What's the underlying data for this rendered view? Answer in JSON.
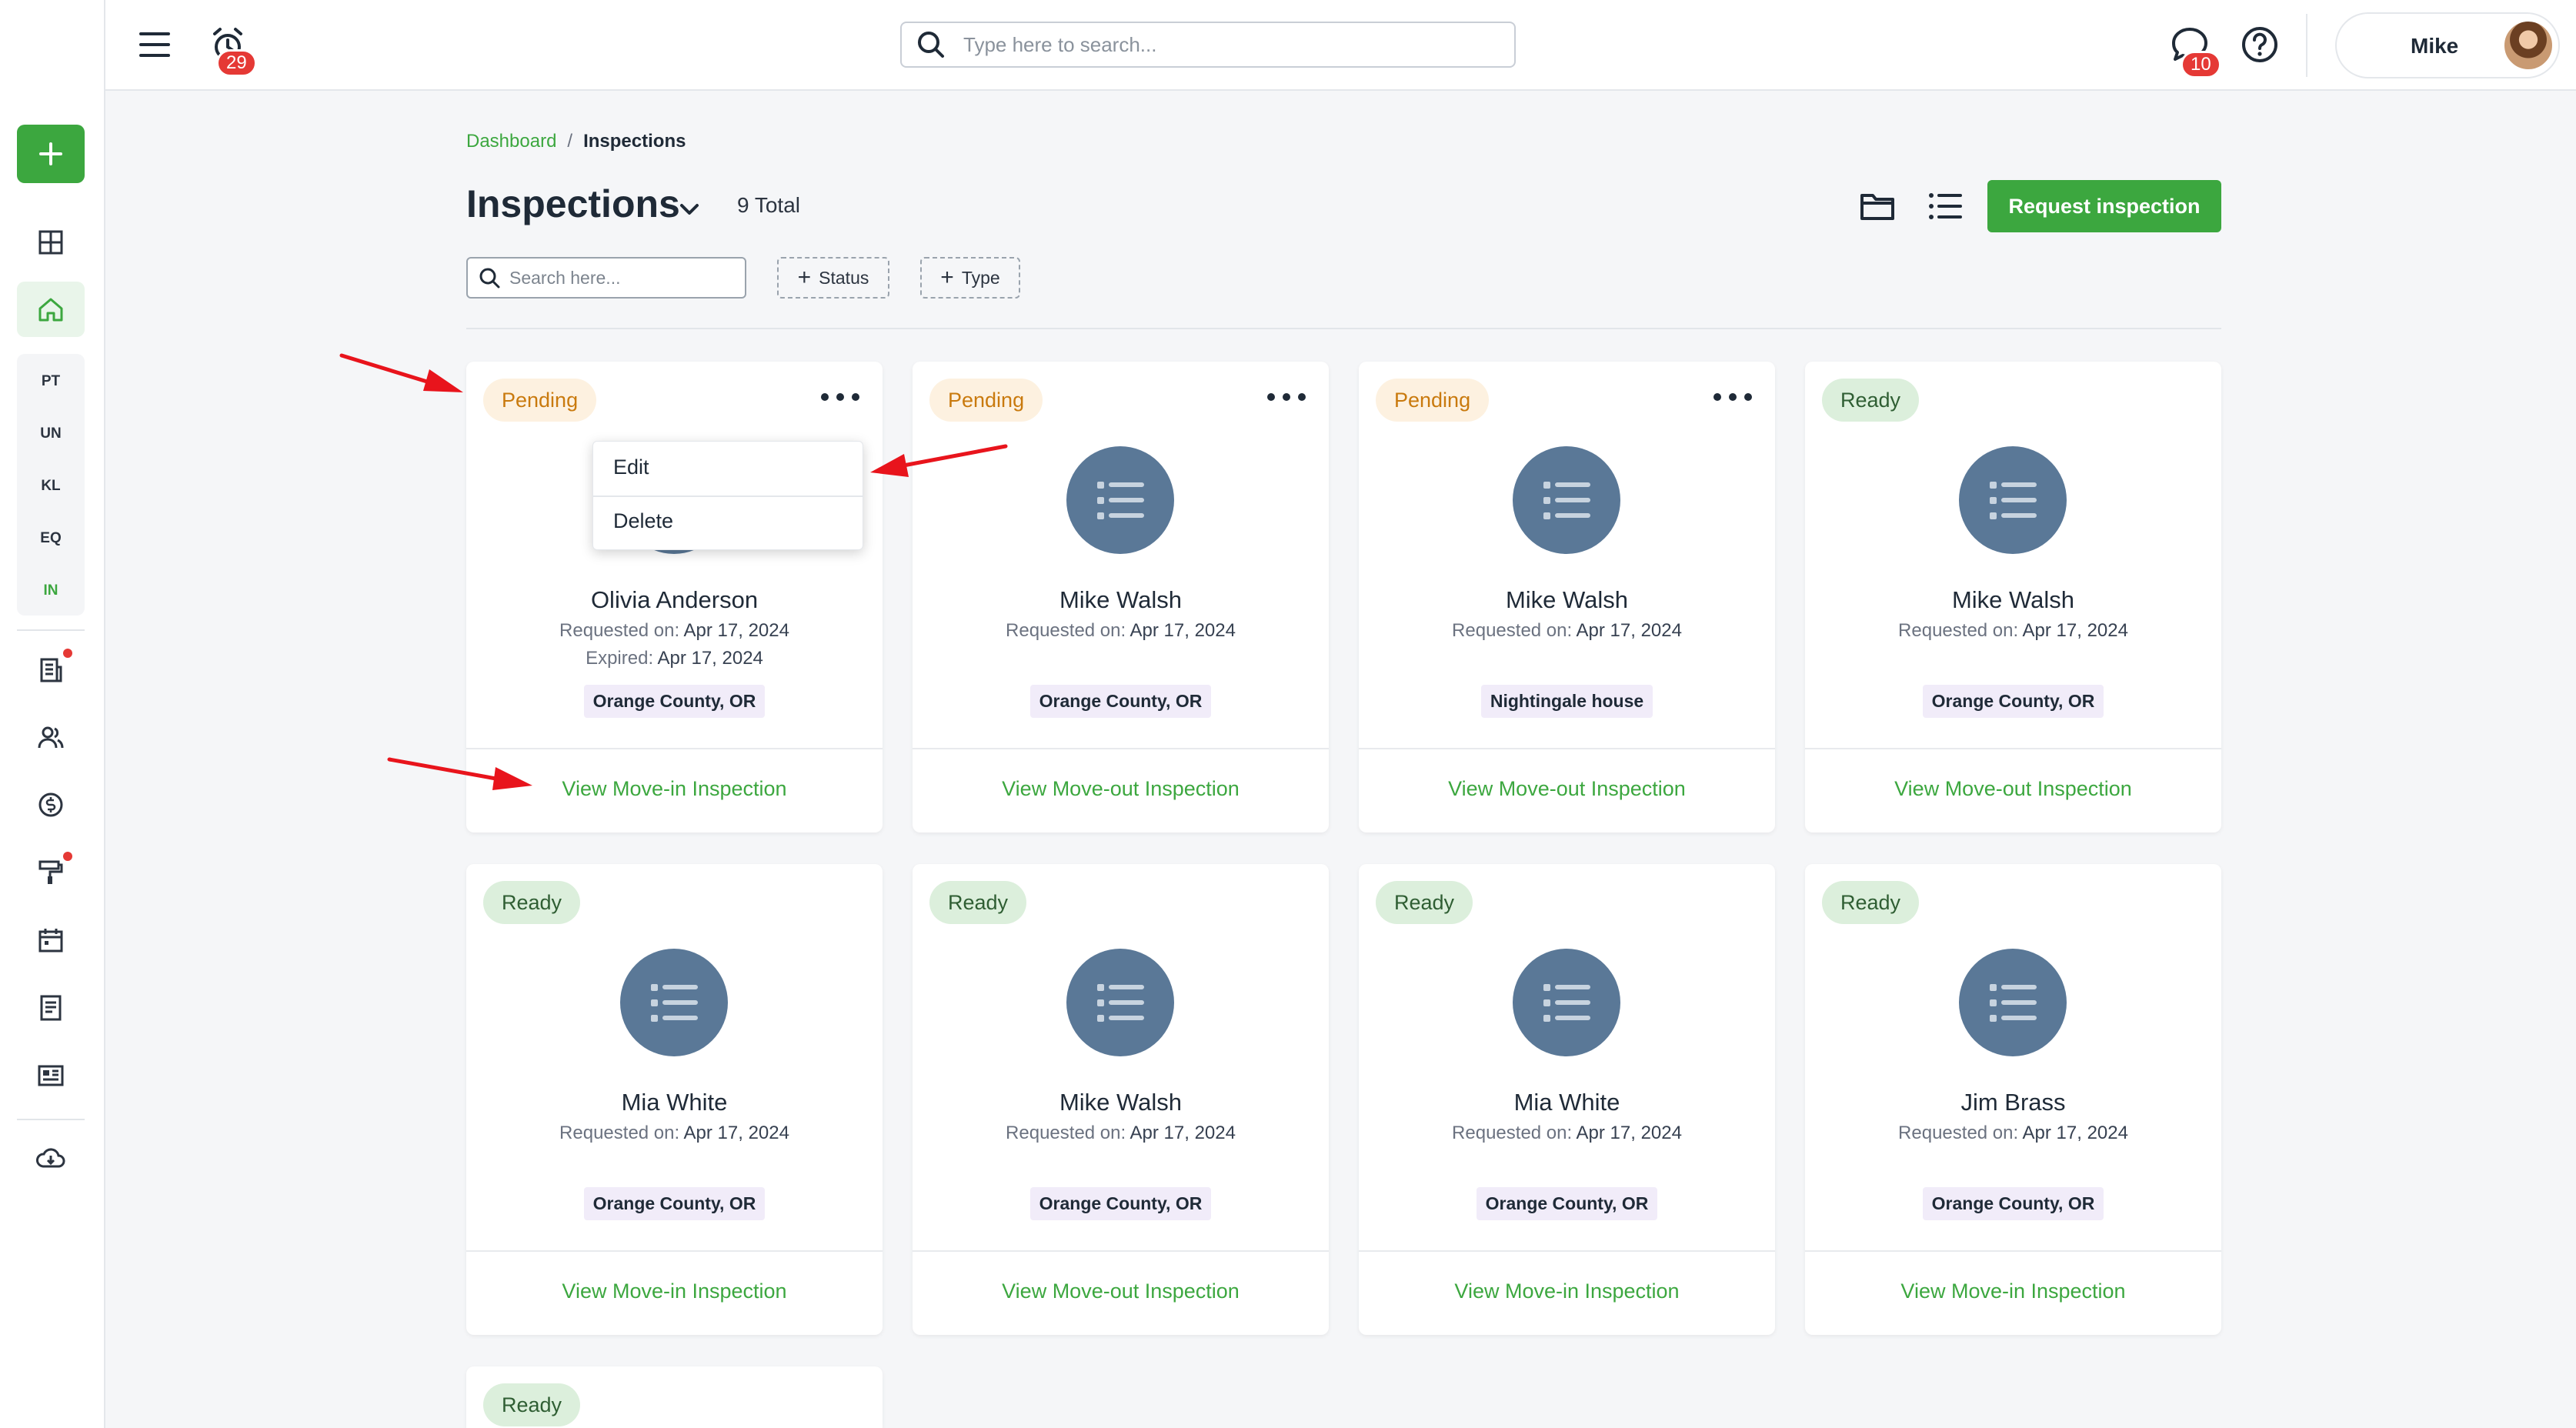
{
  "topbar": {
    "alarm_badge": "29",
    "search_placeholder": "Type here to search...",
    "chat_badge": "10",
    "user_name": "Mike"
  },
  "sidebar": {
    "abbreviations": [
      "PT",
      "UN",
      "KL",
      "EQ",
      "IN"
    ],
    "active_abbreviation": "IN"
  },
  "breadcrumb": {
    "root": "Dashboard",
    "separator": "/",
    "current": "Inspections"
  },
  "header": {
    "title": "Inspections",
    "total": "9 Total",
    "request_button": "Request inspection",
    "filter_search_placeholder": "Search here...",
    "filter_status": "Status",
    "filter_type": "Type"
  },
  "dropdown": {
    "edit": "Edit",
    "delete": "Delete"
  },
  "cards": [
    {
      "status": "Pending",
      "name": "Olivia Anderson",
      "requested_label": "Requested on:",
      "requested": "Apr 17, 2024",
      "expired_label": "Expired:",
      "expired": "Apr 17, 2024",
      "location": "Orange County, OR",
      "link": "View Move-in Inspection"
    },
    {
      "status": "Pending",
      "name": "Mike Walsh",
      "requested_label": "Requested on:",
      "requested": "Apr 17, 2024",
      "location": "Orange County, OR",
      "link": "View Move-out Inspection"
    },
    {
      "status": "Pending",
      "name": "Mike Walsh",
      "requested_label": "Requested on:",
      "requested": "Apr 17, 2024",
      "location": "Nightingale house",
      "link": "View Move-out Inspection"
    },
    {
      "status": "Ready",
      "name": "Mike Walsh",
      "requested_label": "Requested on:",
      "requested": "Apr 17, 2024",
      "location": "Orange County, OR",
      "link": "View Move-out Inspection"
    },
    {
      "status": "Ready",
      "name": "Mia White",
      "requested_label": "Requested on:",
      "requested": "Apr 17, 2024",
      "location": "Orange County, OR",
      "link": "View Move-in Inspection"
    },
    {
      "status": "Ready",
      "name": "Mike Walsh",
      "requested_label": "Requested on:",
      "requested": "Apr 17, 2024",
      "location": "Orange County, OR",
      "link": "View Move-out Inspection"
    },
    {
      "status": "Ready",
      "name": "Mia White",
      "requested_label": "Requested on:",
      "requested": "Apr 17, 2024",
      "location": "Orange County, OR",
      "link": "View Move-in Inspection"
    },
    {
      "status": "Ready",
      "name": "Jim Brass",
      "requested_label": "Requested on:",
      "requested": "Apr 17, 2024",
      "location": "Orange County, OR",
      "link": "View Move-in Inspection"
    },
    {
      "status": "Ready"
    }
  ],
  "colors": {
    "accent_green": "#3ca73f",
    "pending_text": "#c97a0e",
    "ready_text": "#2f5e33",
    "avatar_circle": "#5a7897",
    "badge_red": "#e53935",
    "annotation_arrow": "#e8141c"
  }
}
